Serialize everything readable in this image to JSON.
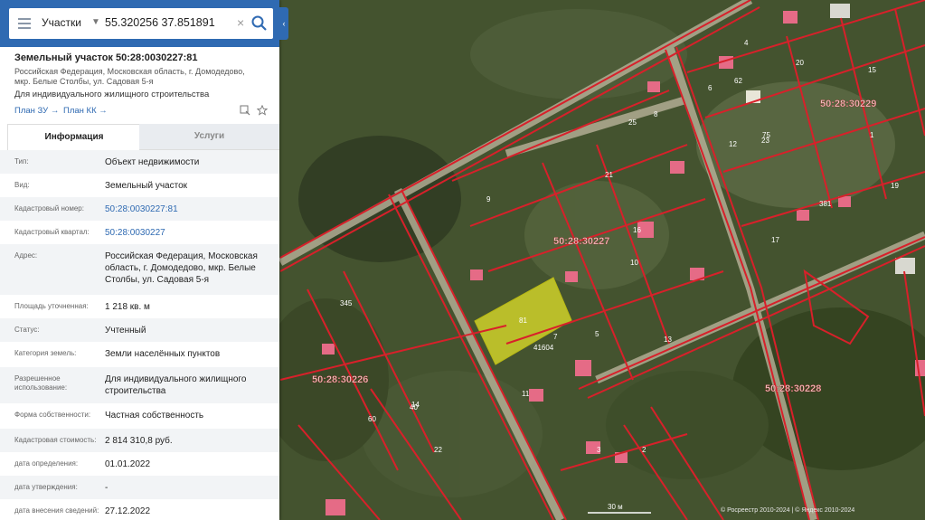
{
  "search": {
    "layer": "Участки",
    "value": "55.320256 37.851891",
    "clear": "×"
  },
  "object": {
    "title": "Земельный участок 50:28:0030227:81",
    "address": "Российская Федерация, Московская область, г. Домодедово, мкр. Белые Столбы, ул. Садовая 5-я",
    "purpose": "Для индивидуального жилищного строительства",
    "plan_zu": "План ЗУ →",
    "plan_kk": "План КК →"
  },
  "tabs": {
    "info": "Информация",
    "services": "Услуги"
  },
  "rows": [
    {
      "label": "Тип:",
      "value": "Объект недвижимости"
    },
    {
      "label": "Вид:",
      "value": "Земельный участок"
    },
    {
      "label": "Кадастровый номер:",
      "value": "50:28:0030227:81"
    },
    {
      "label": "Кадастровый квартал:",
      "value": "50:28:0030227"
    },
    {
      "label": "Адрес:",
      "value": "Российская Федерация, Московская область, г. Домодедово, мкр. Белые Столбы, ул. Садовая 5-я"
    },
    {
      "label": "Площадь уточненная:",
      "value": "1 218 кв. м"
    },
    {
      "label": "Статус:",
      "value": "Учтенный"
    },
    {
      "label": "Категория земель:",
      "value": "Земли населённых пунктов"
    },
    {
      "label": "Разрешенное использование:",
      "value": "Для индивидуального жилищного строительства"
    },
    {
      "label": "Форма собственности:",
      "value": "Частная собственность"
    },
    {
      "label": "Кадастровая стоимость:",
      "value": "2 814 310,8 руб."
    },
    {
      "label": "дата определения:",
      "value": "01.01.2022"
    },
    {
      "label": "дата утверждения:",
      "value": "-"
    },
    {
      "label": "дата внесения сведений:",
      "value": "27.12.2022"
    }
  ],
  "map": {
    "quarters": [
      "50:28:30229",
      "50:28:30227",
      "50:28:30226",
      "50:28:30228"
    ],
    "selected_parcel": "81",
    "parcel_numbers": [
      "4",
      "6",
      "8",
      "10",
      "12",
      "17",
      "20",
      "21",
      "23",
      "13",
      "11",
      "19",
      "9",
      "7",
      "5",
      "3",
      "2",
      "1",
      "15",
      "14",
      "16",
      "22",
      "25",
      "381",
      "345",
      "41604",
      "60",
      "40",
      "75",
      "62",
      "26"
    ],
    "scale": "30 м",
    "attribution": "© Росреестр 2010-2024 | © Яндекс 2010-2024",
    "highlight_color": "#e2e22a",
    "boundary_color": "#d8202a"
  },
  "colors": {
    "accent": "#2f6ab2"
  }
}
